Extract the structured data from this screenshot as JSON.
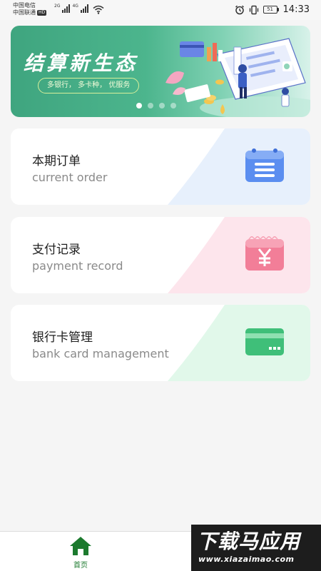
{
  "status_bar": {
    "carrier_1": "中国电信",
    "carrier_2": "中国联通",
    "hd_badge": "HD",
    "net_1": "2G",
    "net_2": "4G",
    "battery": "51",
    "time": "14:33"
  },
  "banner": {
    "title": "结算新生态",
    "subtitle": "多银行， 多卡种， 优服务",
    "slide_count": 4,
    "active_slide": 1
  },
  "cards": [
    {
      "title": "本期订单",
      "subtitle": "current order",
      "icon": "order-list-icon",
      "accent": "#5b8ef0"
    },
    {
      "title": "支付记录",
      "subtitle": "payment record",
      "icon": "yuan-receipt-icon",
      "accent": "#f27e98"
    },
    {
      "title": "银行卡管理",
      "subtitle": "bank card management",
      "icon": "bank-card-icon",
      "accent": "#3fbf79"
    }
  ],
  "tabbar": {
    "home_label": "首页",
    "home_icon": "home-icon",
    "active_color": "#1c7a2e"
  },
  "watermark": {
    "brand": "下载马应用",
    "url": "www.xiazaimao.com"
  }
}
